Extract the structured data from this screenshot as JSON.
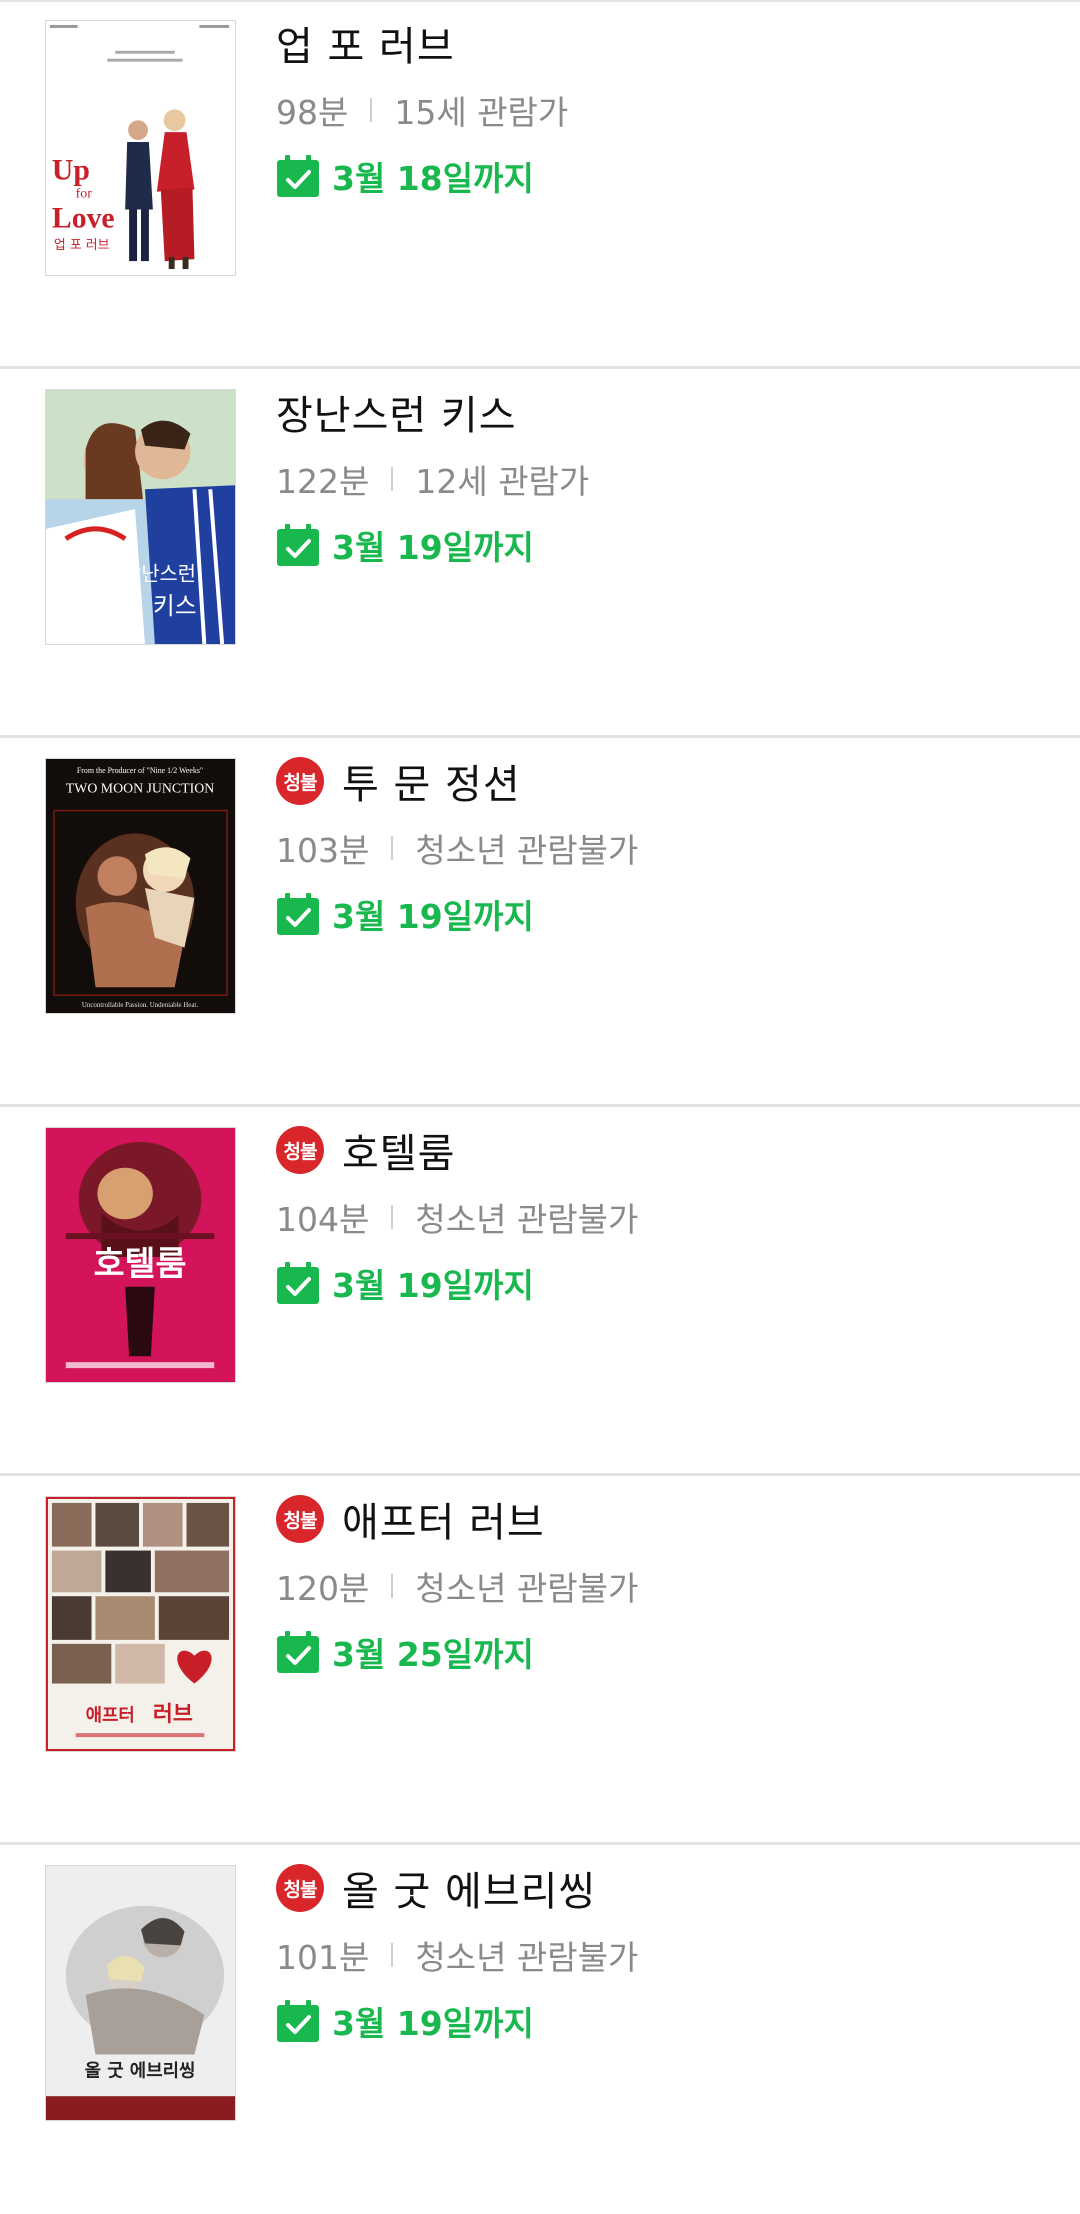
{
  "movies": [
    {
      "title": "업 포 러브",
      "runtime": "98분",
      "age_rating": "15세 관람가",
      "adult_badge": null,
      "until": "3월 18일까지",
      "poster": {
        "bg": "#ffffff",
        "accent": "#c8202a",
        "texts": [
          "Up",
          "for",
          "Love",
          "업 포 러브"
        ]
      }
    },
    {
      "title": "장난스런 키스",
      "runtime": "122분",
      "age_rating": "12세 관람가",
      "adult_badge": null,
      "until": "3월 19일까지",
      "poster": {
        "bg": "#a8c8e0",
        "accent": "#2040a0",
        "texts": [
          "장난스런",
          "키스"
        ]
      }
    },
    {
      "title": "투 문 정션",
      "runtime": "103분",
      "age_rating": "청소년 관람불가",
      "adult_badge": "청불",
      "until": "3월 19일까지",
      "poster": {
        "bg": "#120c0a",
        "accent": "#d88c60",
        "texts": [
          "From the Producer of \"Nine 1/2 Weeks\"",
          "TWO MOON JUNCTION",
          "Uncontrollable Passion. Undeniable Heat."
        ]
      }
    },
    {
      "title": "호텔룸",
      "runtime": "104분",
      "age_rating": "청소년 관람불가",
      "adult_badge": "청불",
      "until": "3월 19일까지",
      "poster": {
        "bg": "#d4145a",
        "accent": "#6a1020",
        "texts": [
          "호텔룸"
        ]
      }
    },
    {
      "title": "애프터 러브",
      "runtime": "120분",
      "age_rating": "청소년 관람불가",
      "adult_badge": "청불",
      "until": "3월 25일까지",
      "poster": {
        "bg": "#f4f0ea",
        "accent": "#c81e28",
        "texts": [
          "애프터",
          "러브"
        ]
      }
    },
    {
      "title": "올 굿 에브리씽",
      "runtime": "101분",
      "age_rating": "청소년 관람불가",
      "adult_badge": "청불",
      "until": "3월 19일까지",
      "poster": {
        "bg": "#eeeeee",
        "accent": "#8a1c20",
        "texts": [
          "올 굿 에브리씽"
        ]
      }
    }
  ],
  "colors": {
    "title": "#111111",
    "meta": "#8a8a8a",
    "until_green": "#19b84f",
    "badge_red": "#d9262b",
    "divider": "#e3e3e3"
  }
}
